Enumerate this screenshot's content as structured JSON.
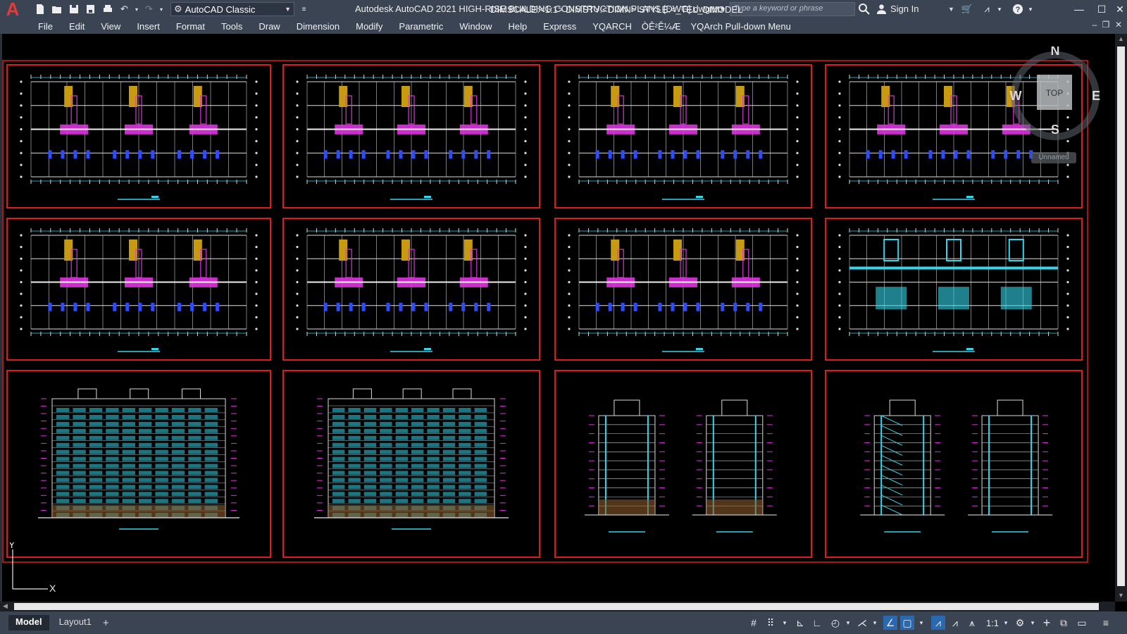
{
  "app": {
    "title": "Autodesk AutoCAD 2021   HIGH-RISE BUILDING CONSTRUCTION PLANS [DWG].dwg",
    "logo": "A",
    "workspace": "AutoCAD Classic",
    "search_placeholder": "Type a keyword or phrase",
    "sign_in": "Sign In"
  },
  "menu": [
    "File",
    "Edit",
    "View",
    "Insert",
    "Format",
    "Tools",
    "Draw",
    "Dimension",
    "Modify",
    "Parametric",
    "Window",
    "Help",
    "Express",
    "YQARCH",
    "ÒÊ²Ê¼Æ",
    "YQArch Pull-down Menu"
  ],
  "viewcube": {
    "north": "N",
    "south": "S",
    "east": "E",
    "west": "W",
    "face": "TOP",
    "ucs": "Unnamed"
  },
  "ucs_icon": {
    "y": "Y",
    "x": "X"
  },
  "tabs": {
    "model": "Model",
    "layout1": "Layout1",
    "add": "+"
  },
  "status": {
    "dimscale": "DIMSCALE:<1:1> DIMSTY:<DIMN> STYLE:<_TEL_DIM>",
    "model": "MODEL",
    "annotation_scale": "1:1"
  },
  "colors": {
    "frame": "#e11b1b",
    "accent": "#2a68b0",
    "titlebar": "#3b4453",
    "cyan": "#33d6ea",
    "magenta": "#e033e0",
    "blue": "#2b4cff",
    "gold": "#c89a10"
  },
  "icons": {
    "titlebar": [
      "new-icon",
      "open-icon",
      "save-icon",
      "save-as-icon",
      "plot-icon",
      "undo-icon",
      "redo-icon",
      "gear-icon"
    ],
    "status": [
      "grid-icon",
      "snap-icon",
      "ortho-icon",
      "polar-icon",
      "isodraft-icon",
      "osnap-icon",
      "dynucs-icon",
      "annotation-visibility-icon",
      "autoscale-icon",
      "annotation-scale-icon",
      "workspace-gear-icon",
      "plus-icon",
      "isolate-icon",
      "hardware-accel-icon",
      "customize-icon"
    ]
  }
}
